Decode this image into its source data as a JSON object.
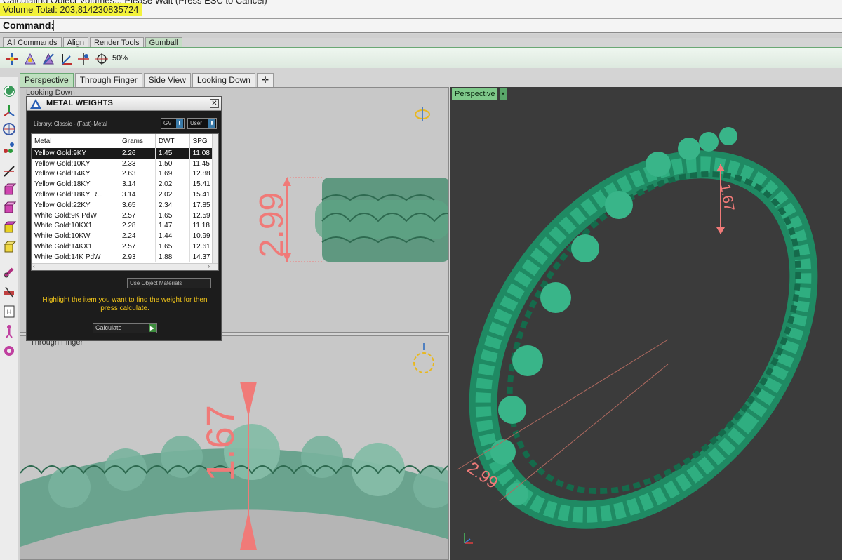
{
  "history": {
    "line1": "Calculating Object Volumes... Please Wait (Press ESC to Cancel)",
    "line2": "Volume Total: 203,814230835724"
  },
  "command": {
    "label": "Command:"
  },
  "toolbar_tabs": [
    "All Commands",
    "Align",
    "Render Tools",
    "Gumball"
  ],
  "toolbar": {
    "zoom": "50%"
  },
  "viewport_tabs": [
    "Perspective",
    "Through Finger",
    "Side View",
    "Looking Down"
  ],
  "viewports": {
    "looking_down": {
      "label": "Looking Down",
      "dimension": "2.99"
    },
    "through_finger": {
      "label": "Through Finger",
      "dimension": "1.67"
    },
    "perspective": {
      "label": "Perspective",
      "dim_top": "1.67",
      "dim_bottom": "2.99"
    }
  },
  "metal_weights": {
    "title": "METAL WEIGHTS",
    "library": "Library: Classic - (Fast)-Metal",
    "gv_select": "GV",
    "user_select": "User",
    "columns": [
      "Metal",
      "Grams",
      "DWT",
      "SPG"
    ],
    "rows": [
      [
        "Yellow Gold:9KY",
        "2.26",
        "1.45",
        "11.08"
      ],
      [
        "Yellow Gold:10KY",
        "2.33",
        "1.50",
        "11.45"
      ],
      [
        "Yellow Gold:14KY",
        "2.63",
        "1.69",
        "12.88"
      ],
      [
        "Yellow Gold:18KY",
        "3.14",
        "2.02",
        "15.41"
      ],
      [
        "Yellow Gold:18KY R...",
        "3.14",
        "2.02",
        "15.41"
      ],
      [
        "Yellow Gold:22KY",
        "3.65",
        "2.34",
        "17.85"
      ],
      [
        "White Gold:9K PdW",
        "2.57",
        "1.65",
        "12.59"
      ],
      [
        "White Gold:10KX1",
        "2.28",
        "1.47",
        "11.18"
      ],
      [
        "White Gold:10KW",
        "2.24",
        "1.44",
        "10.99"
      ],
      [
        "White Gold:14KX1",
        "2.57",
        "1.65",
        "12.61"
      ],
      [
        "White Gold:14K PdW",
        "2.93",
        "1.88",
        "14.37"
      ]
    ],
    "use_object_materials": "Use Object Materials",
    "hint": "Highlight the item you want to find the weight for then press calculate.",
    "calculate": "Calculate"
  },
  "colors": {
    "accent_green": "#6aa874",
    "ring_green": "#2a9a6e",
    "dimension_red": "#f07a78",
    "hint_yellow": "#f0c419"
  }
}
